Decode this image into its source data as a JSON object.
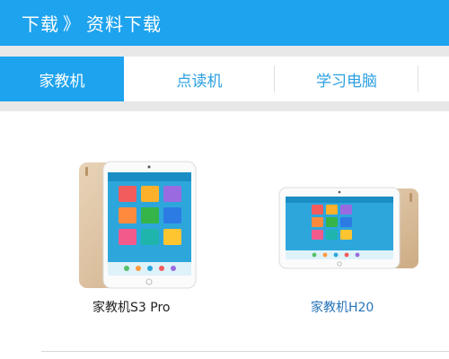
{
  "header": {
    "breadcrumb_root": "下载",
    "breadcrumb_separator": "》",
    "breadcrumb_current": "资料下载",
    "background_color": "#1ea3ee"
  },
  "tabs": [
    {
      "label": "家教机",
      "active": true
    },
    {
      "label": "点读机",
      "active": false
    },
    {
      "label": "学习电脑",
      "active": false
    }
  ],
  "products": [
    {
      "name": "家教机S3 Pro",
      "image": "tablet-portrait-gold"
    },
    {
      "name": "家教机H20",
      "image": "tablet-landscape-gold"
    }
  ],
  "colors": {
    "accent": "#1ea3ee",
    "tab_text": "#2a9fe0",
    "link": "#2673b8",
    "band": "#e8e8e8"
  }
}
